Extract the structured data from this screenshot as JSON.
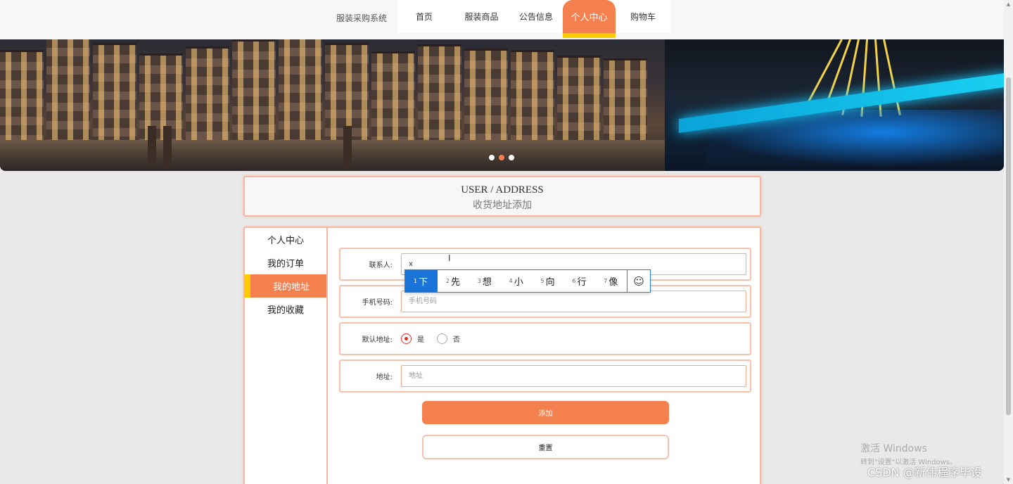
{
  "header": {
    "brand": "服装采购系统",
    "nav": [
      "首页",
      "服装商品",
      "公告信息",
      "个人中心",
      "购物车"
    ],
    "active_nav": "个人中心"
  },
  "banner": {
    "slide_count": 3,
    "active_slide": 2
  },
  "title": {
    "en": "USER / ADDRESS",
    "cn": "收货地址添加"
  },
  "sidebar": {
    "items": [
      {
        "label": "个人中心"
      },
      {
        "label": "我的订单"
      },
      {
        "label": "我的地址"
      },
      {
        "label": "我的收藏"
      }
    ],
    "active": "我的地址"
  },
  "form": {
    "contact": {
      "label": "联系人:",
      "value": "x",
      "placeholder": ""
    },
    "phone": {
      "label": "手机号码:",
      "value": "",
      "placeholder": "手机号码"
    },
    "default": {
      "label": "默认地址:",
      "yes": "是",
      "no": "否",
      "selected": "是"
    },
    "address": {
      "label": "地址:",
      "value": "",
      "placeholder": "地址"
    },
    "submit_label": "添加",
    "reset_label": "重置"
  },
  "ime": {
    "candidates": [
      {
        "num": "1",
        "text": "下"
      },
      {
        "num": "2",
        "text": "先"
      },
      {
        "num": "3",
        "text": "想"
      },
      {
        "num": "4",
        "text": "小"
      },
      {
        "num": "5",
        "text": "向"
      },
      {
        "num": "6",
        "text": "行"
      },
      {
        "num": "7",
        "text": "像"
      }
    ],
    "selected_index": 0,
    "emoji_icon": "☺"
  },
  "watermarks": {
    "windows_line1": "激活 Windows",
    "windows_line2": "转到\"设置\"以激活 Windows。",
    "csdn": "CSDN @新伟程序毕设"
  },
  "colors": {
    "accent": "#f47f4f",
    "highlight": "#ffcc00",
    "border": "#f7b6a0",
    "ime_select": "#1a73d6"
  }
}
